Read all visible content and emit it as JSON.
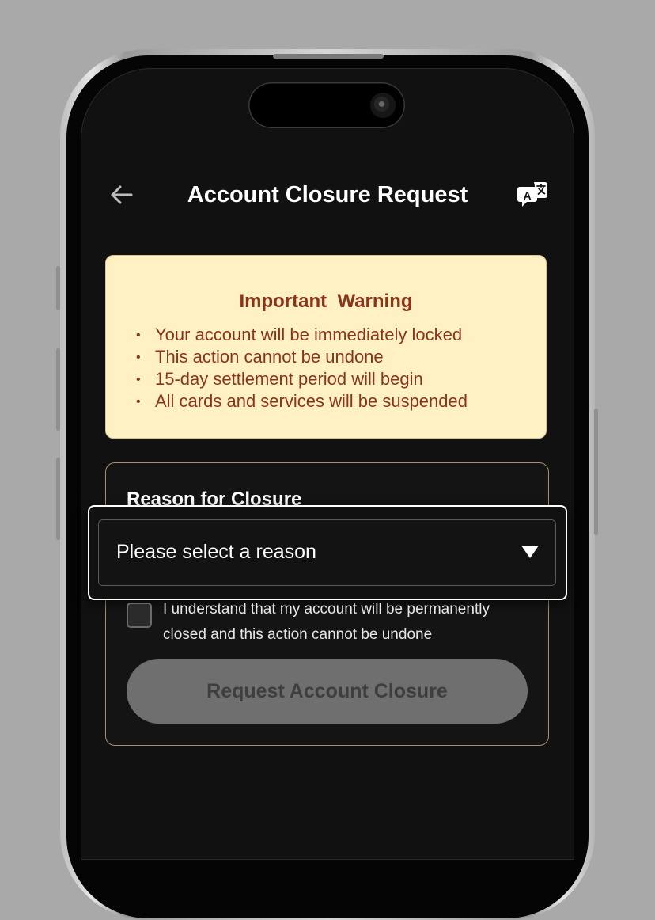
{
  "header": {
    "title": "Account Closure Request",
    "back_icon": "arrow-left-icon",
    "translate_icon": "translate-icon"
  },
  "warning": {
    "title": "Important  Warning",
    "items": [
      "Your account will be immediately locked",
      "This action cannot be undone",
      "15-day settlement period will begin",
      "All cards and services will be suspended"
    ]
  },
  "form": {
    "reason_label": "Reason for Closure",
    "select_value": "Please select a reason",
    "select_icon": "caret-down-icon",
    "confirm_text": "I understand that my account will be permanently closed and this action cannot be undone",
    "confirm_checked": false,
    "submit_label": "Request Account Closure",
    "submit_enabled": false
  },
  "colors": {
    "background": "#111111",
    "warning_bg": "#fff1c4",
    "warning_text": "#8a3418",
    "card_border": "#a8906a",
    "button_disabled_bg": "#6f6f6f",
    "button_disabled_text": "#3e3e3e"
  }
}
